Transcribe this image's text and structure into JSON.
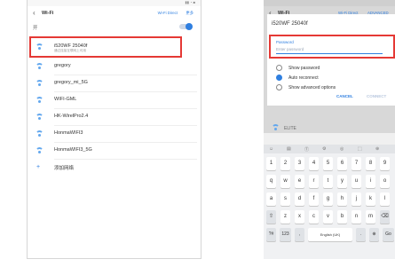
{
  "phone1": {
    "title": "Wi-Fi",
    "back_icon": "back-arrow-icon",
    "wifi_direct": "Wi-Fi Direct",
    "more": "更多",
    "onoff_label": "开",
    "toggle_state": "on",
    "networks": [
      {
        "name": "i520WF 25040f",
        "sub": "通过连接互联网上可用",
        "highlighted": true
      },
      {
        "name": "gregory",
        "sub": ""
      },
      {
        "name": "gregory_mi_5G",
        "sub": ""
      },
      {
        "name": "WIFI-GML",
        "sub": ""
      },
      {
        "name": "HK-WirelPro2.4",
        "sub": ""
      },
      {
        "name": "HonmaWIFI3",
        "sub": ""
      },
      {
        "name": "HonmaWIFI3_5G",
        "sub": ""
      }
    ],
    "add_network": "添加网络",
    "colors": {
      "accent": "#2f7fe0",
      "wifi": "#62a7ee",
      "highlight": "#e53935"
    }
  },
  "phone2": {
    "title": "Wi-Fi",
    "wifi_direct": "Wi-Fi Direct",
    "advanced": "ADVANCED",
    "dialog": {
      "network_name": "i520WF 25040f",
      "password_label": "Password",
      "password_placeholder": "Enter password",
      "options": [
        {
          "label": "Show password",
          "checked": false
        },
        {
          "label": "Auto reconnect",
          "checked": true
        },
        {
          "label": "Show advanced options",
          "checked": false
        }
      ],
      "cancel": "CANCEL",
      "connect": "CONNECT"
    },
    "below_item": "ELITE",
    "keyboard": {
      "toolbar": [
        "☺",
        "▤",
        "Ⓣ",
        "⚙",
        "◎",
        "⬚",
        "⊕"
      ],
      "row_numbers": [
        "1",
        "2",
        "3",
        "4",
        "5",
        "6",
        "7",
        "8",
        "9"
      ],
      "row_top": [
        "q",
        "w",
        "e",
        "r",
        "t",
        "y",
        "u",
        "i",
        "o"
      ],
      "row_mid": [
        "a",
        "s",
        "d",
        "f",
        "g",
        "h",
        "j",
        "k",
        "l"
      ],
      "row_bot": [
        "⇧",
        "z",
        "x",
        "c",
        "v",
        "b",
        "n",
        "m",
        "⌫"
      ],
      "row_last": [
        "?#",
        "123",
        ",",
        "English (UK)",
        ".",
        "⊕",
        "Go"
      ]
    }
  }
}
